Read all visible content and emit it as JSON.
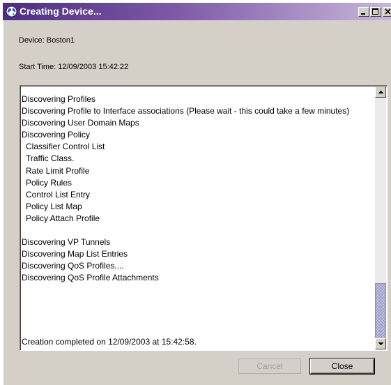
{
  "window": {
    "title": "Creating Device...",
    "title_gradient_start": "#4d2e7e",
    "title_gradient_end": "#c7b6da",
    "controls": [
      "minimize-icon",
      "maximize-icon",
      "close-icon"
    ]
  },
  "device": {
    "label": "Device:  Boston1"
  },
  "start_time": {
    "label": "Start Time: 12/09/2003 15:42:22"
  },
  "log": {
    "lines": [
      {
        "text": "Discovering Profiles",
        "indent": false
      },
      {
        "text": "Discovering Profile to Interface associations (Please wait - this could take a few minutes)",
        "indent": false
      },
      {
        "text": "Discovering User Domain Maps",
        "indent": false
      },
      {
        "text": "Discovering Policy",
        "indent": false
      },
      {
        "text": "Classifier Control List",
        "indent": true
      },
      {
        "text": "Traffic Class.",
        "indent": true
      },
      {
        "text": "Rate Limit Profile",
        "indent": true
      },
      {
        "text": "Policy Rules",
        "indent": true
      },
      {
        "text": "Control List Entry",
        "indent": true
      },
      {
        "text": "Policy List Map",
        "indent": true
      },
      {
        "text": "Policy Attach Profile",
        "indent": true
      },
      {
        "text": "",
        "indent": false
      },
      {
        "text": "Discovering VP Tunnels",
        "indent": false
      },
      {
        "text": "Discovering Map List Entries",
        "indent": false
      },
      {
        "text": "Discovering QoS Profiles....",
        "indent": false
      },
      {
        "text": "Discovering QoS Profile Attachments",
        "indent": false
      }
    ],
    "completion": "Creation completed on 12/09/2003 at 15:42:58.",
    "scroll_position": 0.78
  },
  "buttons": {
    "cancel_label": "Cancel",
    "close_label": "Close"
  }
}
